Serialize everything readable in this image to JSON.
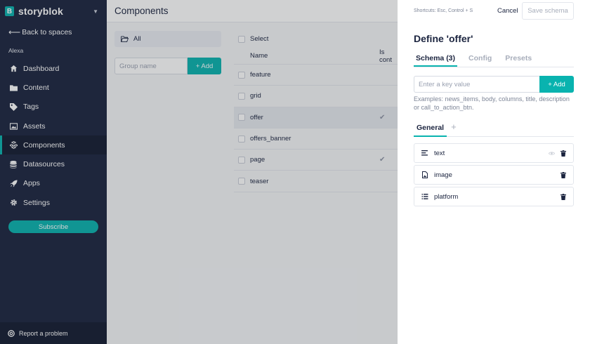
{
  "brand": {
    "name": "storyblok",
    "logo_letter": "B"
  },
  "sidebar": {
    "back_label": "Back to spaces",
    "space_name": "Alexa",
    "items": [
      {
        "label": "Dashboard",
        "icon": "home-icon"
      },
      {
        "label": "Content",
        "icon": "folder-icon"
      },
      {
        "label": "Tags",
        "icon": "tag-icon"
      },
      {
        "label": "Assets",
        "icon": "image-icon"
      },
      {
        "label": "Components",
        "icon": "components-icon",
        "active": true
      },
      {
        "label": "Datasources",
        "icon": "database-icon"
      },
      {
        "label": "Apps",
        "icon": "rocket-icon"
      },
      {
        "label": "Settings",
        "icon": "gear-icon"
      }
    ],
    "subscribe_label": "Subscribe",
    "report_label": "Report a problem"
  },
  "main": {
    "title": "Components",
    "group_all_label": "All",
    "group_name_placeholder": "Group name",
    "group_add_label": "+ Add",
    "select_label": "Select",
    "table": {
      "col_name": "Name",
      "col_content": "Is cont",
      "rows": [
        {
          "name": "feature",
          "is_content": false
        },
        {
          "name": "grid",
          "is_content": false
        },
        {
          "name": "offer",
          "is_content": true,
          "selected": true
        },
        {
          "name": "offers_banner",
          "is_content": false
        },
        {
          "name": "page",
          "is_content": true
        },
        {
          "name": "teaser",
          "is_content": false
        }
      ]
    }
  },
  "panel": {
    "shortcuts": "Shortcuts: Esc, Control + S",
    "cancel_label": "Cancel",
    "save_label": "Save schema",
    "title": "Define 'offer'",
    "tabs": [
      {
        "label": "Schema (3)",
        "active": true
      },
      {
        "label": "Config"
      },
      {
        "label": "Presets"
      }
    ],
    "key_placeholder": "Enter a key value",
    "key_add_label": "+ Add",
    "examples": "Examples: news_items, body, columns, title, description or call_to_action_btn.",
    "sub_tab": "General",
    "sub_add": "+",
    "fields": [
      {
        "name": "text",
        "icon": "text-lines-icon"
      },
      {
        "name": "image",
        "icon": "image-file-icon"
      },
      {
        "name": "platform",
        "icon": "list-icon"
      }
    ]
  },
  "colors": {
    "accent": "#09b3af",
    "sidebar": "#1b243f"
  }
}
